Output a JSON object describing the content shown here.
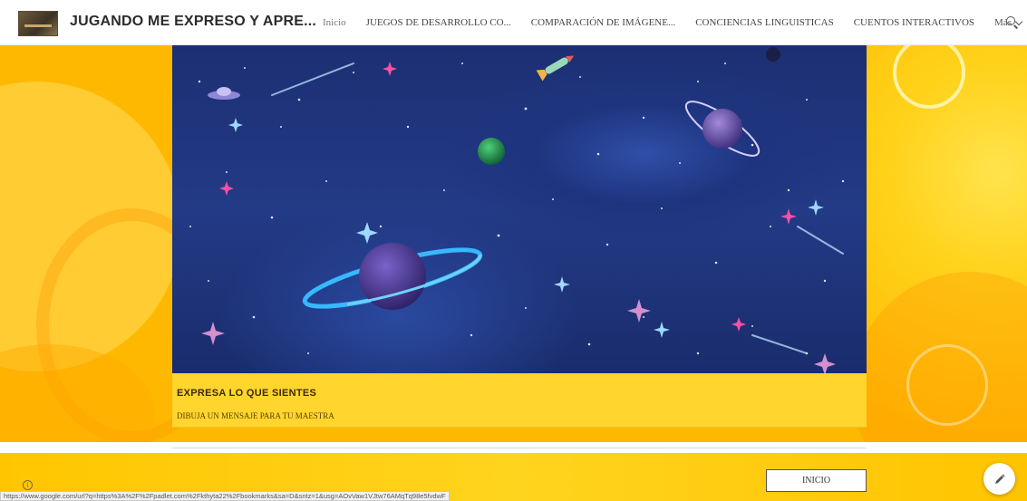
{
  "header": {
    "site_title": "JUGANDO ME EXPRESO Y APRE...",
    "logo_icon": "site-logo-image",
    "nav_items": [
      "Inicio",
      "JUEGOS DE DESARROLLO CO...",
      "COMPARACIÓN DE IMÁGENE...",
      "CONCIENCIAS LINGUISTICAS",
      "CUENTOS INTERACTIVOS"
    ],
    "more_label": "Más",
    "more_icon": "chevron-down-icon",
    "search_icon": "search-icon"
  },
  "hero": {
    "image_description_icon": "space-illustration",
    "caption_title": "EXPRESA LO QUE SIENTES",
    "caption_subtitle": "DIBUJA UN MENSAJE PARA TU MAESTRA"
  },
  "footer": {
    "inicio_button": "INICIO",
    "edit_icon": "pencil-icon",
    "info_icon": "info-icon",
    "info_glyph": "i",
    "status_url": "https://www.google.com/url?q=https%3A%2F%2Fpadlet.com%2Fkthyta22%2Fbookmarks&sa=D&sntz=1&usg=AOvVaw1VJtw76AMqTq98e5fvdwF"
  },
  "colors": {
    "accent_yellow": "#ffd21a",
    "caption_yellow": "#ffd52e",
    "space_blue": "#1d2f73"
  }
}
